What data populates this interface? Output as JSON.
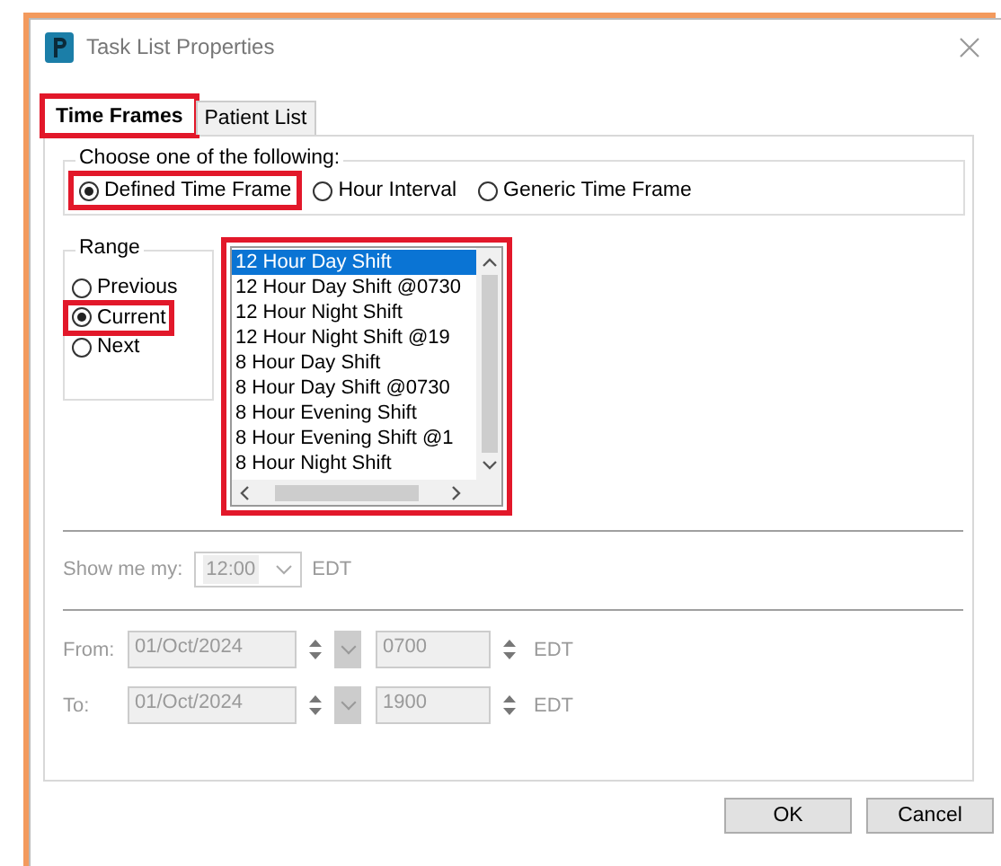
{
  "window": {
    "title": "Task List Properties"
  },
  "tabs": [
    {
      "label": "Time Frames",
      "selected": true,
      "highlighted": true
    },
    {
      "label": "Patient List",
      "selected": false,
      "highlighted": false
    }
  ],
  "choose_group": {
    "legend": "Choose one of the following:",
    "options": [
      {
        "label": "Defined Time Frame",
        "selected": true,
        "highlighted": true
      },
      {
        "label": "Hour Interval",
        "selected": false,
        "highlighted": false
      },
      {
        "label": "Generic Time Frame",
        "selected": false,
        "highlighted": false
      }
    ]
  },
  "range": {
    "legend": "Range",
    "options": [
      {
        "label": "Previous",
        "selected": false,
        "highlighted": false
      },
      {
        "label": "Current",
        "selected": true,
        "highlighted": true
      },
      {
        "label": "Next",
        "selected": false,
        "highlighted": false
      }
    ]
  },
  "shift_list": {
    "highlighted": true,
    "items": [
      {
        "label": "12 Hour Day Shift",
        "selected": true
      },
      {
        "label": "12 Hour Day Shift @0730",
        "selected": false
      },
      {
        "label": "12 Hour Night Shift",
        "selected": false
      },
      {
        "label": "12 Hour Night Shift @19",
        "selected": false
      },
      {
        "label": "8 Hour Day Shift",
        "selected": false
      },
      {
        "label": "8 Hour Day Shift @0730",
        "selected": false
      },
      {
        "label": "8 Hour Evening Shift",
        "selected": false
      },
      {
        "label": "8 Hour Evening Shift @1",
        "selected": false
      },
      {
        "label": "8 Hour Night Shift",
        "selected": false
      }
    ]
  },
  "show_me": {
    "label": "Show me my:",
    "value": "12:00",
    "zone": "EDT",
    "disabled": true
  },
  "range_rows": [
    {
      "label": "From:",
      "date": "01/Oct/2024",
      "time": "0700",
      "zone": "EDT",
      "disabled": true
    },
    {
      "label": "To:",
      "date": "01/Oct/2024",
      "time": "1900",
      "zone": "EDT",
      "disabled": true
    }
  ],
  "buttons": [
    "OK",
    "Cancel"
  ]
}
